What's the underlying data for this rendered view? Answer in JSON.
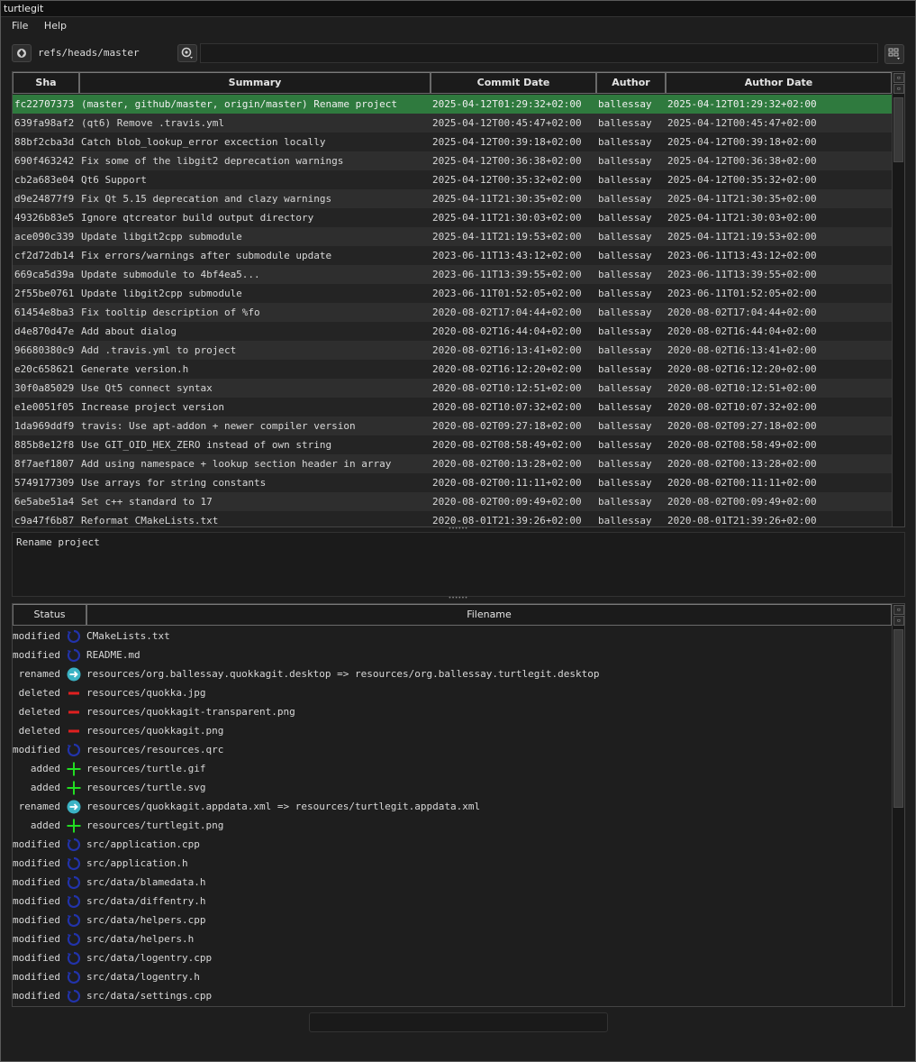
{
  "window": {
    "title": "turtlegit"
  },
  "menu": {
    "file": "File",
    "help": "Help"
  },
  "toolbar": {
    "branch": "refs/heads/master",
    "filter_value": ""
  },
  "commits": {
    "headers": {
      "sha": "Sha",
      "summary": "Summary",
      "commit_date": "Commit Date",
      "author": "Author",
      "author_date": "Author Date"
    },
    "rows": [
      {
        "sha": "fc22707373",
        "summary": "(master, github/master, origin/master) Rename project",
        "commit_date": "2025-04-12T01:29:32+02:00",
        "author": "ballessay",
        "author_date": "2025-04-12T01:29:32+02:00"
      },
      {
        "sha": "639fa98af2",
        "summary": "(qt6) Remove .travis.yml",
        "commit_date": "2025-04-12T00:45:47+02:00",
        "author": "ballessay",
        "author_date": "2025-04-12T00:45:47+02:00"
      },
      {
        "sha": "88bf2cba3d",
        "summary": "Catch blob_lookup_error excection locally",
        "commit_date": "2025-04-12T00:39:18+02:00",
        "author": "ballessay",
        "author_date": "2025-04-12T00:39:18+02:00"
      },
      {
        "sha": "690f463242",
        "summary": "Fix some of the libgit2 deprecation warnings",
        "commit_date": "2025-04-12T00:36:38+02:00",
        "author": "ballessay",
        "author_date": "2025-04-12T00:36:38+02:00"
      },
      {
        "sha": "cb2a683e04",
        "summary": "Qt6 Support",
        "commit_date": "2025-04-12T00:35:32+02:00",
        "author": "ballessay",
        "author_date": "2025-04-12T00:35:32+02:00"
      },
      {
        "sha": "d9e24877f9",
        "summary": "Fix Qt 5.15 deprecation and clazy warnings",
        "commit_date": "2025-04-11T21:30:35+02:00",
        "author": "ballessay",
        "author_date": "2025-04-11T21:30:35+02:00"
      },
      {
        "sha": "49326b83e5",
        "summary": "Ignore qtcreator build output directory",
        "commit_date": "2025-04-11T21:30:03+02:00",
        "author": "ballessay",
        "author_date": "2025-04-11T21:30:03+02:00"
      },
      {
        "sha": "ace090c339",
        "summary": "Update libgit2cpp submodule",
        "commit_date": "2025-04-11T21:19:53+02:00",
        "author": "ballessay",
        "author_date": "2025-04-11T21:19:53+02:00"
      },
      {
        "sha": "cf2d72db14",
        "summary": "Fix errors/warnings after submodule update",
        "commit_date": "2023-06-11T13:43:12+02:00",
        "author": "ballessay",
        "author_date": "2023-06-11T13:43:12+02:00"
      },
      {
        "sha": "669ca5d39a",
        "summary": "Update submodule to 4bf4ea5...",
        "commit_date": "2023-06-11T13:39:55+02:00",
        "author": "ballessay",
        "author_date": "2023-06-11T13:39:55+02:00"
      },
      {
        "sha": "2f55be0761",
        "summary": "Update libgit2cpp submodule",
        "commit_date": "2023-06-11T01:52:05+02:00",
        "author": "ballessay",
        "author_date": "2023-06-11T01:52:05+02:00"
      },
      {
        "sha": "61454e8ba3",
        "summary": "Fix tooltip description of %fo",
        "commit_date": "2020-08-02T17:04:44+02:00",
        "author": "ballessay",
        "author_date": "2020-08-02T17:04:44+02:00"
      },
      {
        "sha": "d4e870d47e",
        "summary": "Add about dialog",
        "commit_date": "2020-08-02T16:44:04+02:00",
        "author": "ballessay",
        "author_date": "2020-08-02T16:44:04+02:00"
      },
      {
        "sha": "96680380c9",
        "summary": "Add .travis.yml to project",
        "commit_date": "2020-08-02T16:13:41+02:00",
        "author": "ballessay",
        "author_date": "2020-08-02T16:13:41+02:00"
      },
      {
        "sha": "e20c658621",
        "summary": "Generate version.h",
        "commit_date": "2020-08-02T16:12:20+02:00",
        "author": "ballessay",
        "author_date": "2020-08-02T16:12:20+02:00"
      },
      {
        "sha": "30f0a85029",
        "summary": "Use Qt5 connect syntax",
        "commit_date": "2020-08-02T10:12:51+02:00",
        "author": "ballessay",
        "author_date": "2020-08-02T10:12:51+02:00"
      },
      {
        "sha": "e1e0051f05",
        "summary": "Increase project version",
        "commit_date": "2020-08-02T10:07:32+02:00",
        "author": "ballessay",
        "author_date": "2020-08-02T10:07:32+02:00"
      },
      {
        "sha": "1da969ddf9",
        "summary": "travis: Use apt-addon + newer compiler version",
        "commit_date": "2020-08-02T09:27:18+02:00",
        "author": "ballessay",
        "author_date": "2020-08-02T09:27:18+02:00"
      },
      {
        "sha": "885b8e12f8",
        "summary": "Use GIT_OID_HEX_ZERO instead of own string",
        "commit_date": "2020-08-02T08:58:49+02:00",
        "author": "ballessay",
        "author_date": "2020-08-02T08:58:49+02:00"
      },
      {
        "sha": "8f7aef1807",
        "summary": "Add using namespace + lookup section header in array",
        "commit_date": "2020-08-02T00:13:28+02:00",
        "author": "ballessay",
        "author_date": "2020-08-02T00:13:28+02:00"
      },
      {
        "sha": "5749177309",
        "summary": "Use arrays for string constants",
        "commit_date": "2020-08-02T00:11:11+02:00",
        "author": "ballessay",
        "author_date": "2020-08-02T00:11:11+02:00"
      },
      {
        "sha": "6e5abe51a4",
        "summary": "Set c++ standard to 17",
        "commit_date": "2020-08-02T00:09:49+02:00",
        "author": "ballessay",
        "author_date": "2020-08-02T00:09:49+02:00"
      },
      {
        "sha": "c9a47f6b87",
        "summary": "Reformat CMakeLists.txt",
        "commit_date": "2020-08-01T21:39:26+02:00",
        "author": "ballessay",
        "author_date": "2020-08-01T21:39:26+02:00"
      }
    ]
  },
  "message": {
    "text": "Rename project"
  },
  "files": {
    "headers": {
      "status": "Status",
      "filename": "Filename"
    },
    "rows": [
      {
        "status": "modified",
        "icon": "modified-icon",
        "filename": "CMakeLists.txt"
      },
      {
        "status": "modified",
        "icon": "modified-icon",
        "filename": "README.md"
      },
      {
        "status": "renamed",
        "icon": "renamed-icon",
        "filename": "resources/org.ballessay.quokkagit.desktop => resources/org.ballessay.turtlegit.desktop"
      },
      {
        "status": "deleted",
        "icon": "deleted-icon",
        "filename": "resources/quokka.jpg"
      },
      {
        "status": "deleted",
        "icon": "deleted-icon",
        "filename": "resources/quokkagit-transparent.png"
      },
      {
        "status": "deleted",
        "icon": "deleted-icon",
        "filename": "resources/quokkagit.png"
      },
      {
        "status": "modified",
        "icon": "modified-icon",
        "filename": "resources/resources.qrc"
      },
      {
        "status": "added",
        "icon": "added-icon",
        "filename": "resources/turtle.gif"
      },
      {
        "status": "added",
        "icon": "added-icon",
        "filename": "resources/turtle.svg"
      },
      {
        "status": "renamed",
        "icon": "renamed-icon",
        "filename": "resources/quokkagit.appdata.xml => resources/turtlegit.appdata.xml"
      },
      {
        "status": "added",
        "icon": "added-icon",
        "filename": "resources/turtlegit.png"
      },
      {
        "status": "modified",
        "icon": "modified-icon",
        "filename": "src/application.cpp"
      },
      {
        "status": "modified",
        "icon": "modified-icon",
        "filename": "src/application.h"
      },
      {
        "status": "modified",
        "icon": "modified-icon",
        "filename": "src/data/blamedata.h"
      },
      {
        "status": "modified",
        "icon": "modified-icon",
        "filename": "src/data/diffentry.h"
      },
      {
        "status": "modified",
        "icon": "modified-icon",
        "filename": "src/data/helpers.cpp"
      },
      {
        "status": "modified",
        "icon": "modified-icon",
        "filename": "src/data/helpers.h"
      },
      {
        "status": "modified",
        "icon": "modified-icon",
        "filename": "src/data/logentry.cpp"
      },
      {
        "status": "modified",
        "icon": "modified-icon",
        "filename": "src/data/logentry.h"
      },
      {
        "status": "modified",
        "icon": "modified-icon",
        "filename": "src/data/settings.cpp"
      }
    ]
  },
  "colors": {
    "selected_row": "#2f7a3e",
    "modified": "#2233aa",
    "renamed": "#3bb3c4",
    "deleted": "#e02020",
    "added": "#22dd22"
  }
}
